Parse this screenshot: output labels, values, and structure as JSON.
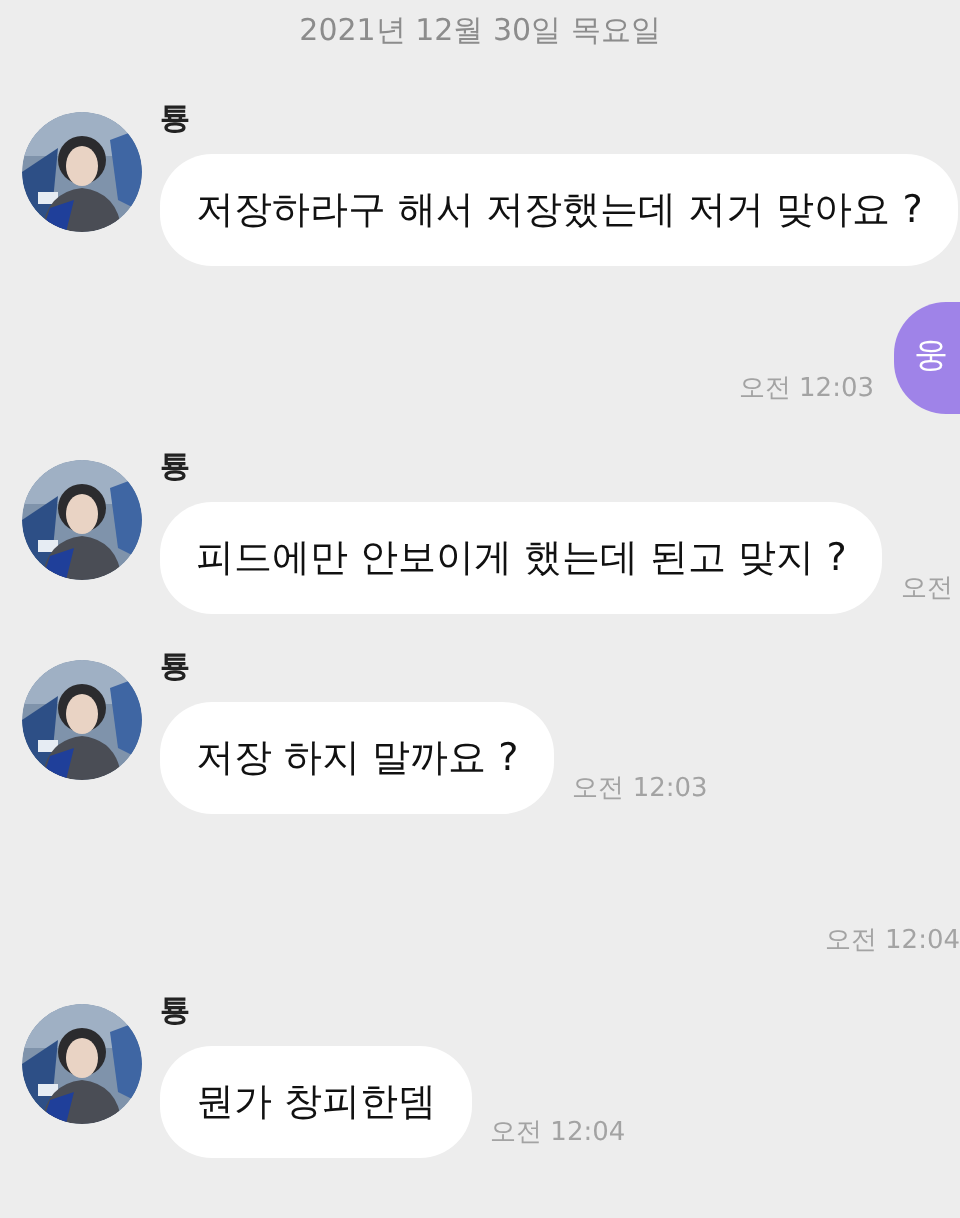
{
  "date_divider": "2021년 12월 30일 목요일",
  "messages": [
    {
      "kind": "incoming",
      "sender": "툥",
      "text": "저장하라구 해서 저장했는데 저거 맞아요 ?"
    },
    {
      "kind": "outgoing",
      "text": "웅",
      "time": "오전 12:03"
    },
    {
      "kind": "incoming",
      "sender": "툥",
      "text": "피드에만 안보이게 했는데 된고 맞지 ?",
      "time": "오전"
    },
    {
      "kind": "incoming",
      "sender": "툥",
      "text": "저장 하지 말까요 ?",
      "time": "오전 12:03"
    },
    {
      "kind": "time_only",
      "time": "오전 12:04"
    },
    {
      "kind": "incoming",
      "sender": "툥",
      "text": "뭔가 창피한뎀",
      "time": "오전 12:04"
    }
  ]
}
